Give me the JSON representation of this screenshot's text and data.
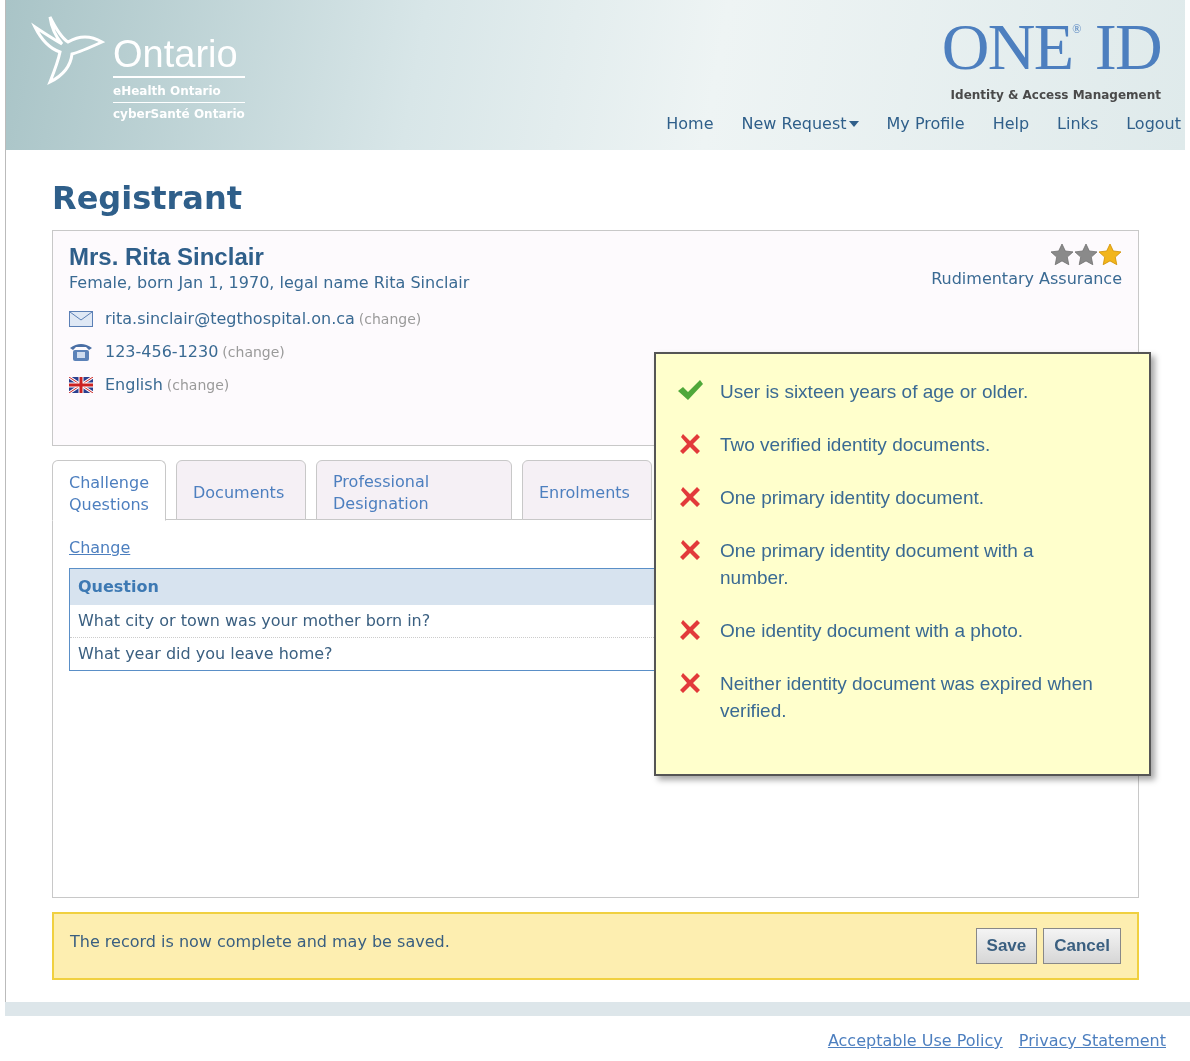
{
  "header": {
    "logo": {
      "name": "Ontario",
      "line_1": "eHealth Ontario",
      "line_2": "cyberSanté Ontario"
    },
    "product": {
      "name": "ONE$^{®}$ ID",
      "tagline": "Identity & Access Management"
    },
    "nav": [
      {
        "label": "Home",
        "has_menu": false
      },
      {
        "label": "New Request",
        "has_menu": true
      },
      {
        "label": "My Profile",
        "has_menu": false
      },
      {
        "label": "Help",
        "has_menu": false
      },
      {
        "label": "Links",
        "has_menu": false
      },
      {
        "label": "Logout",
        "has_menu": false
      }
    ]
  },
  "page_title": "Registrant",
  "person": {
    "name": "Mrs. Rita Sinclair",
    "details": "Female, born Jan 1, 1970, legal name Rita Sinclair",
    "stars": 1,
    "assurance": "Rudimentary Assurance",
    "contacts": [
      {
        "kind": "email",
        "value": "rita.sinclair@tegthospital.on.ca",
        "action": "(change)"
      },
      {
        "kind": "phone",
        "value": "123-456-1230",
        "action": "(change)"
      },
      {
        "kind": "language",
        "value": "English",
        "action": "(change)"
      }
    ]
  },
  "tabs": [
    {
      "label": "Challenge Questions",
      "selected": true
    },
    {
      "label": "Documents",
      "selected": false
    },
    {
      "label": "Professional Designation",
      "selected": false
    },
    {
      "label": "Enrolments",
      "selected": false
    }
  ],
  "change_link": "Change",
  "table": {
    "columns": [
      "Question"
    ],
    "rows": [
      [
        "What city or town was your mother born in?"
      ],
      [
        "What year did you leave home?"
      ]
    ]
  },
  "requirements": [
    {
      "text": "User is sixteen years of age or older.",
      "met": true
    },
    {
      "text": "Two verified identity documents.",
      "met": false
    },
    {
      "text": "One primary identity document.",
      "met": false
    },
    {
      "text": "One primary identity document with a number.",
      "met": false
    },
    {
      "text": "One identity document with a photo.",
      "met": false
    },
    {
      "text": "Neither identity document was expired when verified.",
      "met": false
    }
  ],
  "status": {
    "message": "The record is now complete and may be saved.",
    "buttons": [
      "Save",
      "Cancel"
    ]
  },
  "footer": {
    "links": [
      "Acceptable Use Policy",
      "Privacy Statement"
    ]
  }
}
